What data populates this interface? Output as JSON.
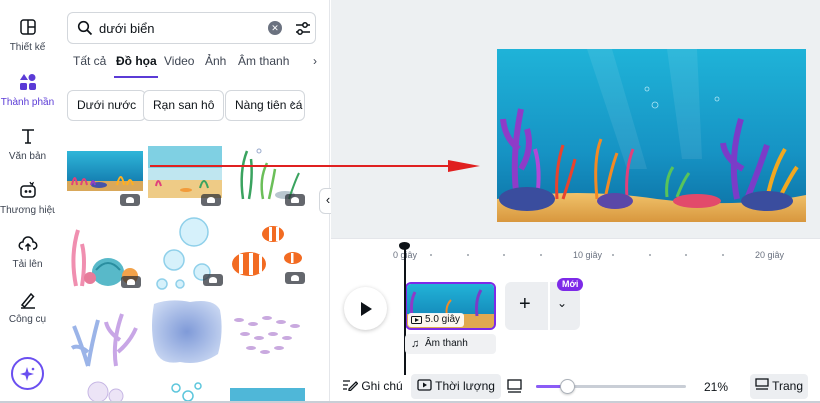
{
  "rail": {
    "items": [
      {
        "label": "Thiết kế",
        "icon": "layout-icon"
      },
      {
        "label": "Thành phần",
        "icon": "elements-icon",
        "active": true
      },
      {
        "label": "Văn bản",
        "icon": "text-icon"
      },
      {
        "label": "Thương hiệu",
        "icon": "brand-icon"
      },
      {
        "label": "Tải lên",
        "icon": "upload-icon"
      },
      {
        "label": "Công cụ",
        "icon": "tools-icon"
      }
    ],
    "magic_icon": "sparkle-icon"
  },
  "panel": {
    "search": {
      "value": "dưới biển",
      "clear_icon": "clear-icon",
      "filter_icon": "filter-icon"
    },
    "tabs": [
      "Tất cả",
      "Đồ họa",
      "Video",
      "Ảnh",
      "Âm thanh"
    ],
    "active_tab": "Đồ họa",
    "chips": [
      "Dưới nước",
      "Rạn san hô",
      "Nàng tiên cá"
    ],
    "collapse_icon": "‹"
  },
  "timeline": {
    "ticks": [
      "0 giây",
      "10 giây",
      "20 giây"
    ],
    "clip_duration": "5.0 giây",
    "audio_label": "Âm thanh",
    "new_badge": "Mới",
    "add_icon": "+",
    "expand_icon": "⌄"
  },
  "bottom_bar": {
    "notes": "Ghi chú",
    "duration": "Thời lượng",
    "zoom": "21%",
    "zoom_fraction": 0.21,
    "pages": "Trang"
  },
  "colors": {
    "accent": "#7d2ae8",
    "active_tab": "#5b3bd6",
    "arrow": "#e02020"
  }
}
